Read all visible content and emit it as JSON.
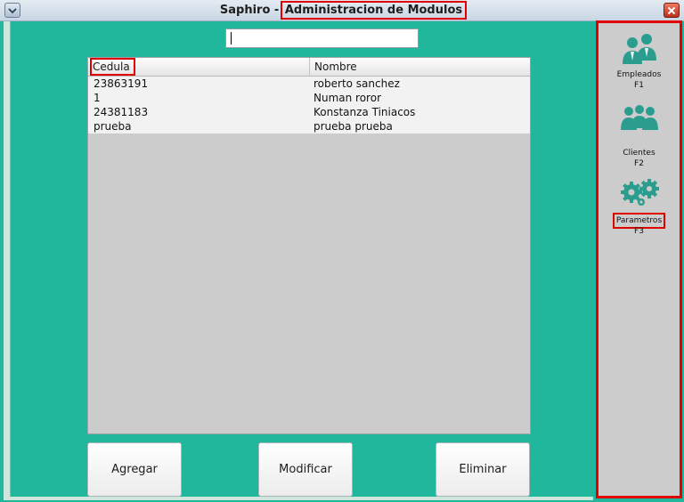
{
  "window": {
    "title_prefix": "Saphiro - ",
    "title_main": "Administracion de Modulos"
  },
  "search": {
    "value": "",
    "placeholder": ""
  },
  "table": {
    "columns": [
      "Cedula",
      "Nombre"
    ],
    "rows": [
      {
        "cedula": "23863191",
        "nombre": "roberto sanchez"
      },
      {
        "cedula": "1",
        "nombre": "Numan roror"
      },
      {
        "cedula": "24381183",
        "nombre": "Konstanza Tiniacos"
      },
      {
        "cedula": "prueba",
        "nombre": "prueba prueba"
      }
    ]
  },
  "actions": {
    "add": "Agregar",
    "modify": "Modificar",
    "delete": "Eliminar"
  },
  "sidebar": {
    "items": [
      {
        "label": "Empleados",
        "shortcut": "F1",
        "icon": "employees-icon"
      },
      {
        "label": "Clientes",
        "shortcut": "F2",
        "icon": "clients-icon"
      },
      {
        "label": "Parametros",
        "shortcut": "F3",
        "icon": "gears-icon"
      }
    ]
  },
  "colors": {
    "background": "#20b79c",
    "icon_teal": "#2a9d8f",
    "highlight": "#e00000"
  }
}
